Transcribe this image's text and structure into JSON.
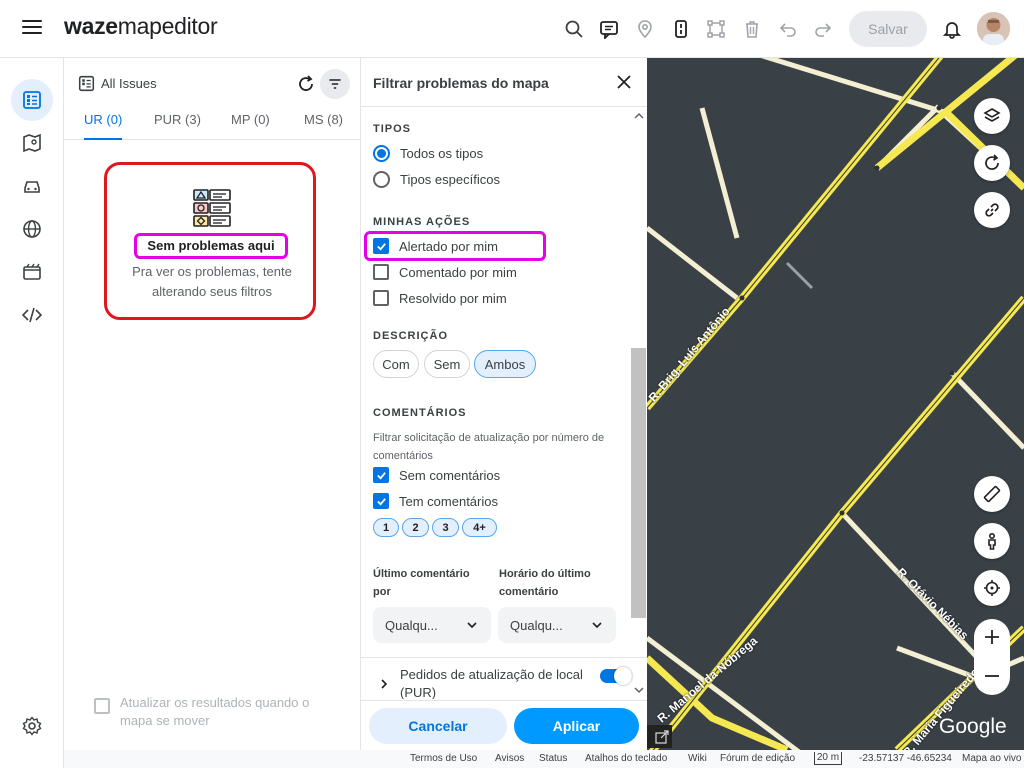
{
  "app": {
    "logo_bold": "waze",
    "logo_rest": "mapeditor",
    "save_label": "Salvar"
  },
  "issues_panel": {
    "title": "All Issues",
    "tabs": [
      {
        "label": "UR (0)",
        "active": true
      },
      {
        "label": "PUR (3)",
        "active": false
      },
      {
        "label": "MP (0)",
        "active": false
      },
      {
        "label": "MS (8)",
        "active": false
      }
    ],
    "empty_title": "Sem problemas aqui",
    "empty_desc": "Pra ver os problemas, tente alterando seus filtros",
    "auto_update_label": "Atualizar os resultados quando o mapa se mover"
  },
  "filter_panel": {
    "title": "Filtrar problemas do mapa",
    "types_heading": "TIPOS",
    "types_options": [
      "Todos os tipos",
      "Tipos específicos"
    ],
    "my_actions_heading": "MINHAS AÇÕES",
    "my_actions": [
      {
        "label": "Alertado por mim",
        "checked": true
      },
      {
        "label": "Comentado por mim",
        "checked": false
      },
      {
        "label": "Resolvido por mim",
        "checked": false
      }
    ],
    "description_heading": "DESCRIÇÃO",
    "description_chips": [
      "Com",
      "Sem",
      "Ambos"
    ],
    "comments_heading": "COMENTÁRIOS",
    "comments_desc": "Filtrar solicitação de atualização por número de comentários",
    "comments_options": [
      {
        "label": "Sem comentários",
        "checked": true
      },
      {
        "label": "Tem comentários",
        "checked": true
      }
    ],
    "comment_counts": [
      "1",
      "2",
      "3",
      "4+"
    ],
    "last_comment_by_label": "Último comentário por",
    "last_comment_time_label": "Horário do último comentário",
    "last_comment_by_value": "Qualqu...",
    "last_comment_time_value": "Qualqu...",
    "pur_label": "Pedidos de atualização de local (PUR)",
    "cancel_label": "Cancelar",
    "apply_label": "Aplicar"
  },
  "map": {
    "streets": [
      "R. Brig. Luís Antônio",
      "R. Otávio Nébias",
      "R. Manoel da Nóbrega",
      "R. Maria Figueiredo"
    ],
    "attribution": "Google",
    "colors": {
      "background": "#394147",
      "major_road": "#f5e850",
      "minor_road": "#f4eed2"
    }
  },
  "footer": {
    "links": [
      "Termos de Uso",
      "Avisos",
      "Status",
      "Atalhos do teclado",
      "Wiki",
      "Fórum de edição"
    ],
    "scale": "20 m",
    "coords": "-23.57137 -46.65234",
    "live_map": "Mapa ao vivo"
  }
}
